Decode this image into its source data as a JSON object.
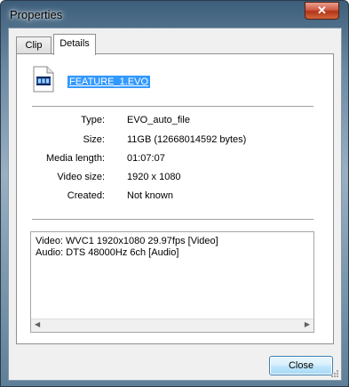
{
  "window": {
    "title": "Properties",
    "close_symbol": "✕"
  },
  "tabs": [
    {
      "label": "Clip",
      "selected": false
    },
    {
      "label": "Details",
      "selected": true
    }
  ],
  "file": {
    "name": "FEATURE_1.EVO",
    "icon": "video-file-icon"
  },
  "properties": [
    {
      "label": "Type:",
      "value": "EVO_auto_file"
    },
    {
      "label": "Size:",
      "value": "11GB (12668014592 bytes)"
    },
    {
      "label": "Media length:",
      "value": "01:07:07"
    },
    {
      "label": "Video size:",
      "value": "1920 x 1080"
    },
    {
      "label": "Created:",
      "value": "Not known"
    }
  ],
  "streams": [
    "Video: WVC1 1920x1080 29.97fps [Video]",
    "Audio: DTS 48000Hz 6ch [Audio]"
  ],
  "buttons": {
    "close": "Close"
  },
  "colors": {
    "selection": "#3399ff",
    "close_accent": "#c0392b"
  }
}
